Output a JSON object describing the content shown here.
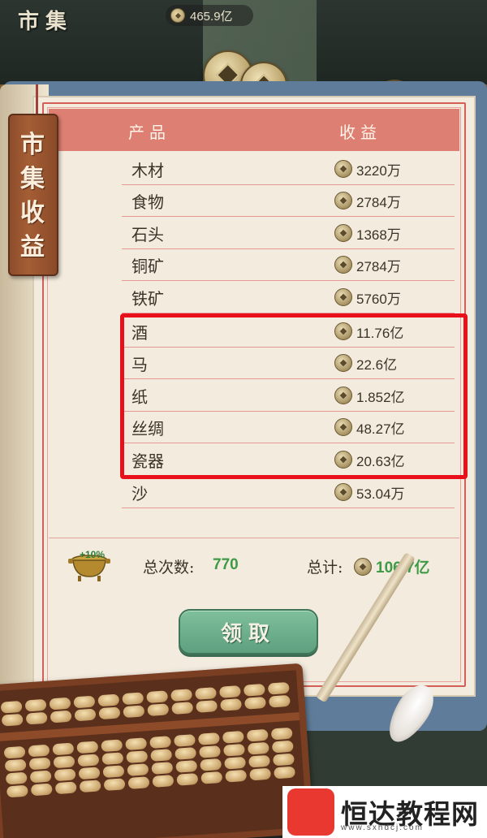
{
  "header": {
    "title": "市集",
    "currency": "465.9亿"
  },
  "bookmark": {
    "text": "市集收益"
  },
  "table": {
    "columns": [
      "产品",
      "收益"
    ],
    "rows": [
      {
        "name": "木材",
        "value": "3220万"
      },
      {
        "name": "食物",
        "value": "2784万"
      },
      {
        "name": "石头",
        "value": "1368万"
      },
      {
        "name": "铜矿",
        "value": "2784万"
      },
      {
        "name": "铁矿",
        "value": "5760万"
      },
      {
        "name": "酒",
        "value": "11.76亿"
      },
      {
        "name": "马",
        "value": "22.6亿"
      },
      {
        "name": "纸",
        "value": "1.852亿"
      },
      {
        "name": "丝绸",
        "value": "48.27亿"
      },
      {
        "name": "瓷器",
        "value": "20.63亿"
      },
      {
        "name": "沙",
        "value": "53.04万"
      }
    ]
  },
  "summary": {
    "bonus": "+10%",
    "count_label": "总次数:",
    "count_value": "770",
    "total_label": "总计:",
    "total_value": "106.7亿"
  },
  "claim_button": {
    "label": "领取"
  },
  "watermark": {
    "logo_char": "恒",
    "text": "恒达教程网",
    "url": "www.sxhdcj.com"
  },
  "colors": {
    "header_band": "#de7f73",
    "highlight": "#e8111b",
    "green_value": "#3f9a45",
    "button": "#6fae8d"
  }
}
